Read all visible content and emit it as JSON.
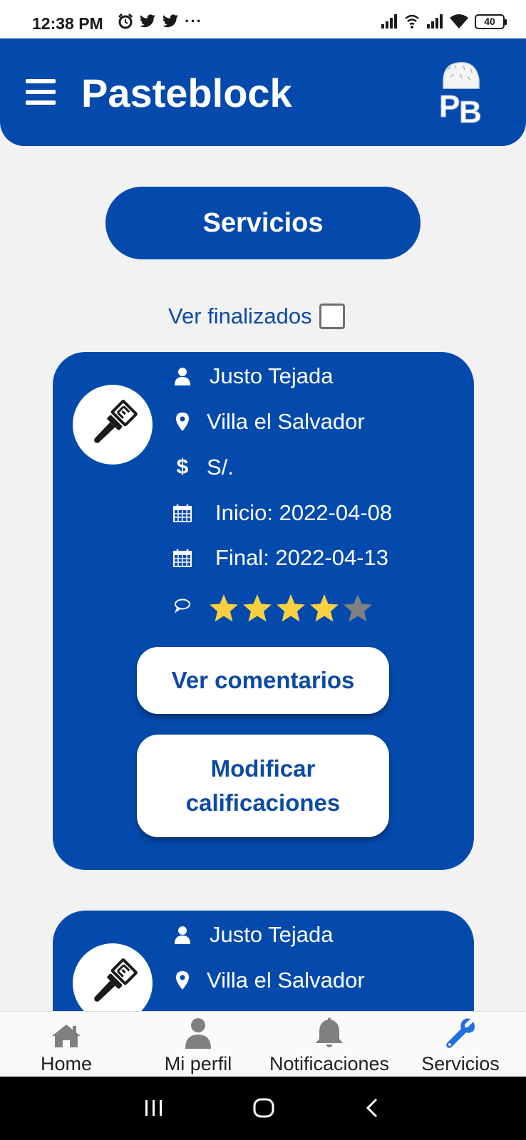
{
  "status_bar": {
    "time": "12:38 PM",
    "battery": "40",
    "more": "···",
    "left_icons": [
      "alarm-icon",
      "twitter-icon",
      "twitter-icon"
    ],
    "right_icons": [
      "signal-icon",
      "wifi-calling-icon",
      "signal-icon",
      "wifi-icon",
      "battery-icon"
    ]
  },
  "header": {
    "title": "Pasteblock",
    "menu_icon": "menu-icon",
    "logo": "pasteblock-logo"
  },
  "page": {
    "section_title": "Servicios",
    "filter_label": "Ver finalizados",
    "filter_checked": false
  },
  "services": [
    {
      "icon": "paint-brush-icon",
      "name": "Justo Tejada",
      "location": "Villa el Salvador",
      "price": "S/.",
      "start": "Inicio: 2022-04-08",
      "end": "Final: 2022-04-13",
      "rating": 4,
      "rating_max": 5,
      "comments_button": "Ver comentarios",
      "modify_button": "Modificar calificaciones"
    },
    {
      "icon": "paint-brush-icon",
      "name": "Justo Tejada",
      "location": "Villa el Salvador"
    }
  ],
  "bottom_nav": [
    {
      "label": "Home",
      "icon": "home-icon",
      "active": false
    },
    {
      "label": "Mi perfil",
      "icon": "user-icon",
      "active": false
    },
    {
      "label": "Notificaciones",
      "icon": "bell-icon",
      "active": false
    },
    {
      "label": "Servicios",
      "icon": "wrench-icon",
      "active": true
    }
  ],
  "colors": {
    "primary": "#044aad",
    "background": "#f2f2f2",
    "star_filled": "#f7d040",
    "star_empty": "#808080",
    "nav_inactive": "#808080",
    "nav_active": "#1e6fe0"
  }
}
